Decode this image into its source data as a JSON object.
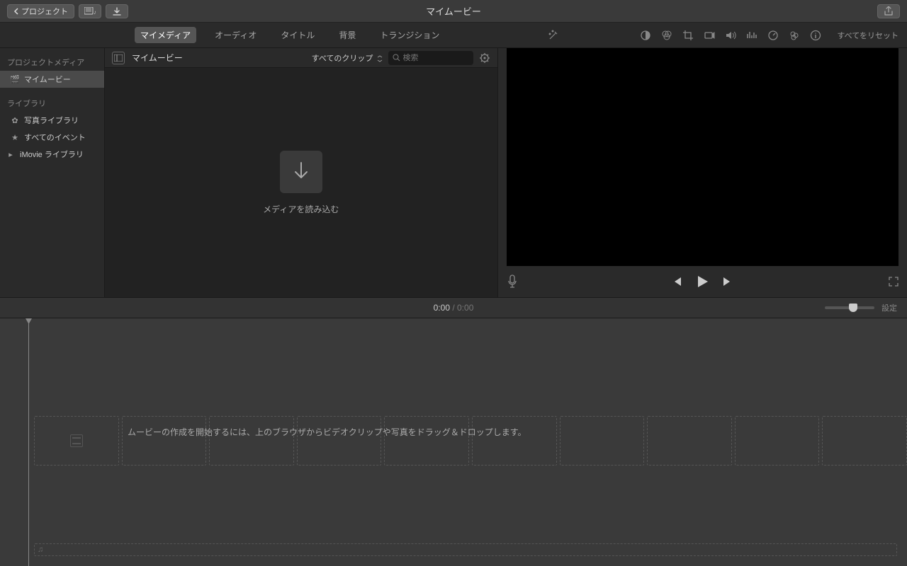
{
  "titlebar": {
    "back_label": "プロジェクト",
    "title": "マイムービー"
  },
  "tabs": {
    "my_media": "マイメディア",
    "audio": "オーディオ",
    "title": "タイトル",
    "background": "背景",
    "transition": "トランジション"
  },
  "player_tools": {
    "reset": "すべてをリセット"
  },
  "sidebar": {
    "project_media_header": "プロジェクトメディア",
    "my_movie": "マイムービー",
    "library_header": "ライブラリ",
    "photo_library": "写真ライブラリ",
    "all_events": "すべてのイベント",
    "imovie_library": "iMovie ライブラリ"
  },
  "browser": {
    "title": "マイムービー",
    "clip_filter": "すべてのクリップ",
    "search_placeholder": "検索",
    "import_label": "メディアを読み込む"
  },
  "timeline": {
    "current_time": "0:00",
    "separator": " / ",
    "total_time": "0:00",
    "settings": "設定",
    "hint": "ムービーの作成を開始するには、上のブラウザからビデオクリップや写真をドラッグ＆ドロップします。"
  }
}
